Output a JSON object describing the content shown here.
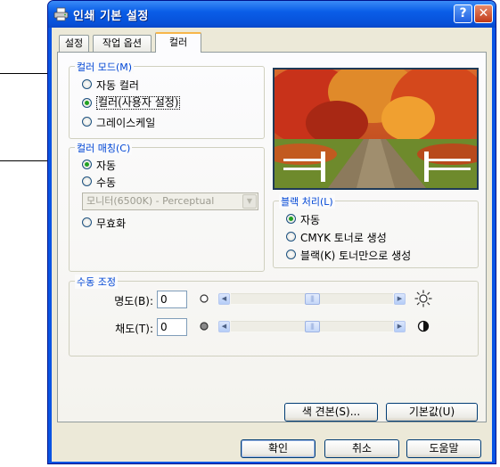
{
  "window": {
    "title": "인쇄 기본 설정",
    "help_label": "?",
    "close_label": "✕"
  },
  "tabs": [
    "설정",
    "작업 옵션",
    "컬러"
  ],
  "color_mode": {
    "legend": "컬러 모드(M)",
    "options": [
      {
        "label": "자동 컬러",
        "selected": false
      },
      {
        "label": "컬러(사용자 설정)",
        "selected": true
      },
      {
        "label": "그레이스케일",
        "selected": false
      }
    ]
  },
  "color_matching": {
    "legend": "컬러 매칭(C)",
    "options": [
      {
        "label": "자동",
        "selected": true
      },
      {
        "label": "수동",
        "selected": false
      },
      {
        "label": "무효화",
        "selected": false
      }
    ],
    "profile_value": "모니터(6500K) - Perceptual"
  },
  "black_processing": {
    "legend": "블랙 처리(L)",
    "options": [
      {
        "label": "자동",
        "selected": true
      },
      {
        "label": "CMYK 토너로 생성",
        "selected": false
      },
      {
        "label": "블랙(K) 토너만으로 생성",
        "selected": false
      }
    ]
  },
  "manual_adjust": {
    "legend": "수동 조정",
    "brightness_label": "명도(B):",
    "brightness_value": "0",
    "saturation_label": "채도(T):",
    "saturation_value": "0",
    "brightness_level": 0.5,
    "saturation_level": 0.5
  },
  "buttons": {
    "color_swatch": "색 견본(S)...",
    "defaults": "기본값(U)",
    "ok": "확인",
    "cancel": "취소",
    "help": "도움말"
  }
}
